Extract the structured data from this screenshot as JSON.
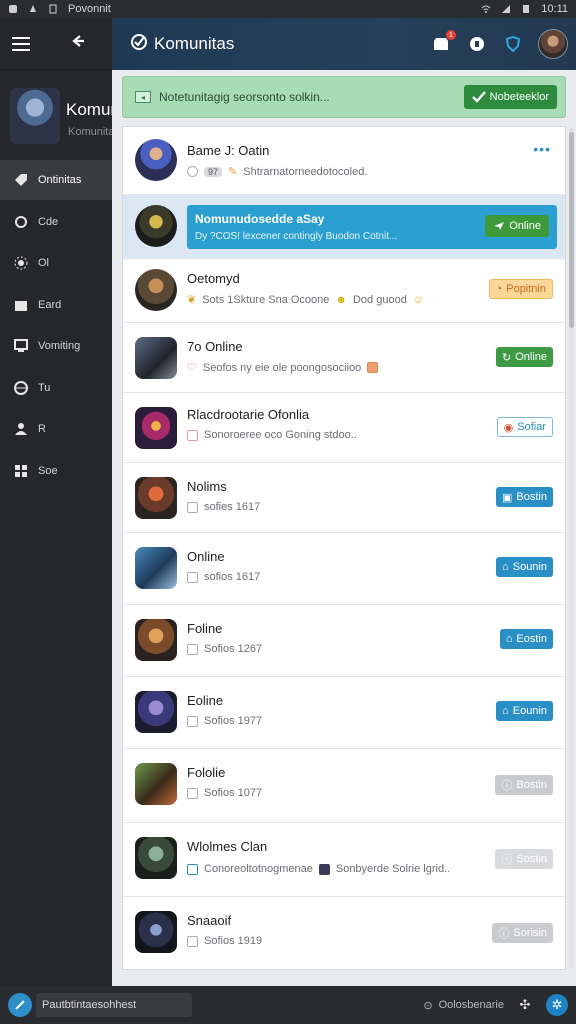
{
  "status_bar": {
    "app_name": "Povonnit",
    "clock": "10:11"
  },
  "sidebar": {
    "profile_name": "Komunitas",
    "profile_sub": "Komunitas",
    "items": [
      {
        "label": "Ontinitas",
        "icon": "tag-icon",
        "active": true
      },
      {
        "label": "Cde",
        "icon": "chat-icon"
      },
      {
        "label": "Ol",
        "icon": "settings-icon"
      },
      {
        "label": "Eard",
        "icon": "board-icon"
      },
      {
        "label": "Vomiting",
        "icon": "monitor-icon"
      },
      {
        "label": "Tu",
        "icon": "globe-icon"
      },
      {
        "label": "R",
        "icon": "user-icon"
      },
      {
        "label": "Soe",
        "icon": "grid-icon"
      }
    ]
  },
  "header": {
    "title": "Komunitas",
    "badge_count": "1"
  },
  "banner": {
    "text": "Notetunitagig seorsonto solkin...",
    "button_label": "Nobeteeklor"
  },
  "list": {
    "rows": [
      {
        "title": "Bame J: Oatin",
        "sub_badge": "97",
        "sub": "Shtrarnatorneedotocoled.",
        "action": "more"
      },
      {
        "title": "Nomunudosedde aSay",
        "sub": "Dy ?COS! lexcener contingly Buodon Cotnit...",
        "action": "Online",
        "highlight": true
      },
      {
        "title": "Oetomyd",
        "sub": "Sots 1Skture Sna Ocoone",
        "sub_extra": "Dod guood",
        "action": "Popitnin"
      },
      {
        "title": "7o Online",
        "sub": "Seofos ny eie ole poongosociioo",
        "action": "Online"
      },
      {
        "title": "Rlacdrootarie Ofonlia",
        "sub": "Sonoroeree oco Goning stdoo..",
        "action": "Sofiar"
      },
      {
        "title": "Nolims",
        "sub": "sofies 1617",
        "action": "Bostin"
      },
      {
        "title": "Online",
        "sub": "sofios 1617",
        "action": "Sounin"
      },
      {
        "title": "Foline",
        "sub": "Sofios 1267",
        "action": "Eostin"
      },
      {
        "title": "Eoline",
        "sub": "Sofios 1977",
        "action": "Eounin"
      },
      {
        "title": "Fololie",
        "sub": "Sofios 1077",
        "action": "Bostin"
      },
      {
        "title": "Wlolmes Clan",
        "sub": "Conoreoltotnogmenae",
        "sub_extra": "Sonbyerde Solrie lgrid..",
        "action": "Sostin"
      },
      {
        "title": "Snaaoif",
        "sub": "Sofios 1919",
        "action": "Sorisin"
      }
    ]
  },
  "bottom_bar": {
    "input_value": "Pautbtintaesohhest",
    "status": "Oolosbenarie"
  },
  "colors": {
    "accent": "#2a9fd0",
    "online": "#3f9a45",
    "header": "#203a55",
    "sidebar": "#26272b"
  }
}
